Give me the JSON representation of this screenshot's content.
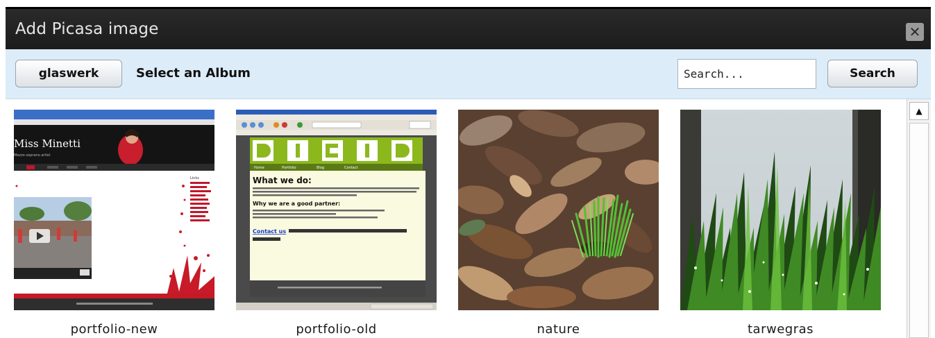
{
  "dialog": {
    "title": "Add Picasa image",
    "close_glyph": "✕"
  },
  "toolbar": {
    "album_button_label": "glaswerk",
    "heading": "Select an Album",
    "search_placeholder": "Search...",
    "search_button_label": "Search"
  },
  "albums": [
    {
      "title": "portfolio-new",
      "preview": {
        "name": "Miss Minetti",
        "subtitle": "Mezzo-soprano artist",
        "sidebar_title": "Links"
      }
    },
    {
      "title": "portfolio-old",
      "preview": {
        "heading": "What we do:",
        "text": "Didd designs and builds websites and online applications - since 1996. A lot has changed since then, but your website visitors still want useable sites that are easy to find and navigate.",
        "subheading": "Why we are a good partner:",
        "bullets": [
          "Sites are build for usability, conform standards (XHTML and CSS).",
          "Projects finished timely and within budget.",
          "Search engine optimised, Google Analytics if needed."
        ],
        "link": "Contact us",
        "cta": "to start improving your web presence.",
        "nav": [
          "Home",
          "Portfolio",
          "Blog",
          "Contact"
        ]
      }
    },
    {
      "title": "nature"
    },
    {
      "title": "tarwegras"
    }
  ],
  "scrollbar": {
    "up_arrow": "▲"
  },
  "colors": {
    "titlebar": "#1c1c1c",
    "toolbar": "#dcecf8",
    "accent_green": "#8cb81e"
  }
}
